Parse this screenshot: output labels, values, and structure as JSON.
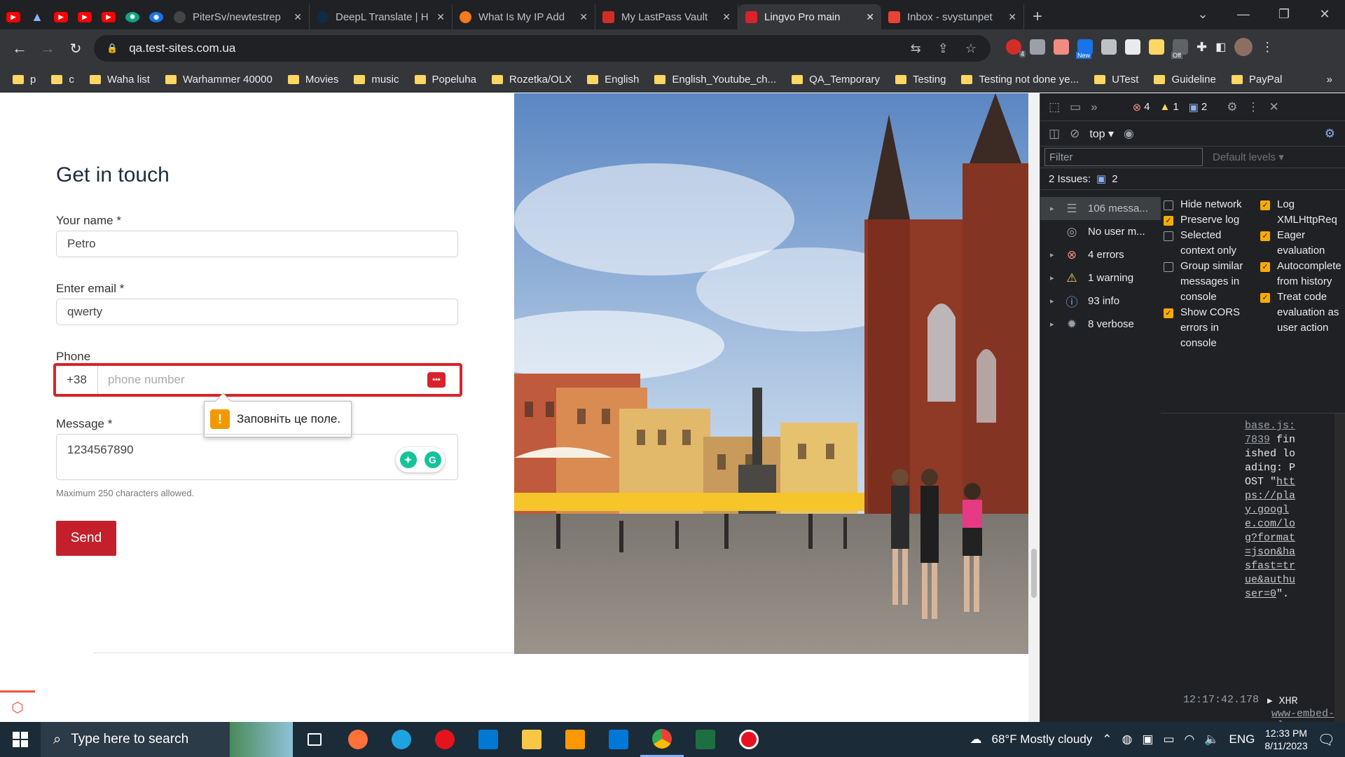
{
  "browser": {
    "tabs": [
      {
        "title": "PiterSv/newtestrep",
        "color": "#24292f"
      },
      {
        "title": "DeepL Translate | H",
        "color": "#0f2b46"
      },
      {
        "title": "What Is My IP Add",
        "color": "#f47b20"
      },
      {
        "title": "My LastPass Vault",
        "color": "#d32d27"
      },
      {
        "title": "Lingvo Pro main",
        "color": "#d9222a"
      },
      {
        "title": "Inbox - svystunpet",
        "color": "#ea4335"
      }
    ],
    "url": "qa.test-sites.com.ua",
    "bookmarks": [
      "p",
      "c",
      "Waha list",
      "Warhammer 40000",
      "Movies",
      "music",
      "Popeluha",
      "Rozetka/OLX",
      "English",
      "English_Youtube_ch...",
      "QA_Temporary",
      "Testing",
      "Testing not done ye...",
      "UTest",
      "Guideline",
      "PayPal"
    ],
    "new_badge": "New",
    "off_badge": "Off",
    "ext_count": "4"
  },
  "form": {
    "title": "Get in touch",
    "name_label": "Your name *",
    "name_value": "Petro",
    "email_label": "Enter email *",
    "email_value": "qwerty",
    "phone_label": "Phone",
    "phone_prefix": "+38",
    "phone_placeholder": "phone number",
    "validation_message": "Заповніть це поле.",
    "message_label": "Message *",
    "message_value": "1234567890",
    "hint": "Maximum 250 characters allowed.",
    "send_label": "Send"
  },
  "devtools": {
    "errors_count": "4",
    "warnings_count": "1",
    "messages_count": "2",
    "context": "top",
    "filter_placeholder": "Filter",
    "levels": "Default levels",
    "issues_label": "2 Issues:",
    "issues_count": "2",
    "sidebar": [
      {
        "label": "106 messa...",
        "icon": "list-icon"
      },
      {
        "label": "No user m...",
        "icon": "user-icon"
      },
      {
        "label": "4 errors",
        "icon": "error-icon"
      },
      {
        "label": "1 warning",
        "icon": "warning-icon"
      },
      {
        "label": "93 info",
        "icon": "info-icon"
      },
      {
        "label": "8 verbose",
        "icon": "bug-icon"
      }
    ],
    "options_left": [
      {
        "label": "Hide network",
        "checked": false
      },
      {
        "label": "Preserve log",
        "checked": true
      },
      {
        "label": "Selected context only",
        "checked": false
      },
      {
        "label": "Group similar messages in console",
        "checked": false
      },
      {
        "label": "Show CORS errors in console",
        "checked": true
      }
    ],
    "options_right": [
      {
        "label": "Log XMLHttpReq",
        "checked": true
      },
      {
        "label": "Eager evaluation",
        "checked": true
      },
      {
        "label": "Autocomplete from history",
        "checked": true
      },
      {
        "label": "Treat code evaluation as user action",
        "checked": true
      }
    ],
    "log_source": "base.js:7839",
    "log_text": "finished loading: POST \"",
    "log_url": "https://play.google.com/log?format=json&hasfast=true&authuser=0",
    "log_tail": "\".",
    "timestamp": "12:17:42.178",
    "xhr_label": "XHR",
    "xhr_link": "www-embed-pl"
  },
  "taskbar": {
    "search_placeholder": "Type here to search",
    "weather": "68°F  Mostly cloudy",
    "language": "ENG",
    "time": "12:33 PM",
    "date": "8/11/2023"
  }
}
